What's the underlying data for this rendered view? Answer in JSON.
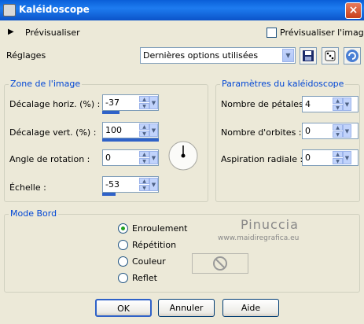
{
  "window": {
    "title": "Kaléidoscope",
    "close_label": "×"
  },
  "preview": {
    "toggle_label": "Prévisualiser",
    "checkbox_label": "Prévisualiser l'image",
    "checked": false
  },
  "settings": {
    "label": "Réglages",
    "preset_value": "Dernières options utilisées"
  },
  "zone": {
    "title": "Zone de l'image",
    "fields": [
      {
        "label": "Décalage horiz. (%) :",
        "value": "-37",
        "level": -37
      },
      {
        "label": "Décalage vert. (%) :",
        "value": "100",
        "level": 100
      },
      {
        "label": "Angle de rotation :",
        "value": "0"
      },
      {
        "label": "Échelle :",
        "value": "-53",
        "level": -53
      }
    ]
  },
  "kaleido": {
    "title": "Paramètres du kaléidoscope",
    "fields": [
      {
        "label": "Nombre de pétales :",
        "value": "4"
      },
      {
        "label": "Nombre d'orbites :",
        "value": "0"
      },
      {
        "label": "Aspiration radiale :",
        "value": "0"
      }
    ]
  },
  "mode": {
    "title": "Mode Bord",
    "options": [
      {
        "label": "Enroulement",
        "selected": true
      },
      {
        "label": "Répétition",
        "selected": false
      },
      {
        "label": "Couleur",
        "selected": false
      },
      {
        "label": "Reflet",
        "selected": false
      }
    ]
  },
  "watermark": {
    "name": "Pinuccia",
    "url": "www.maidiregrafica.eu"
  },
  "buttons": {
    "ok": "OK",
    "cancel": "Annuler",
    "help": "Aide"
  },
  "colors": {
    "accent": "#0046d5",
    "titlebar": "#0a5fd8",
    "selected_radio": "#21a121"
  }
}
